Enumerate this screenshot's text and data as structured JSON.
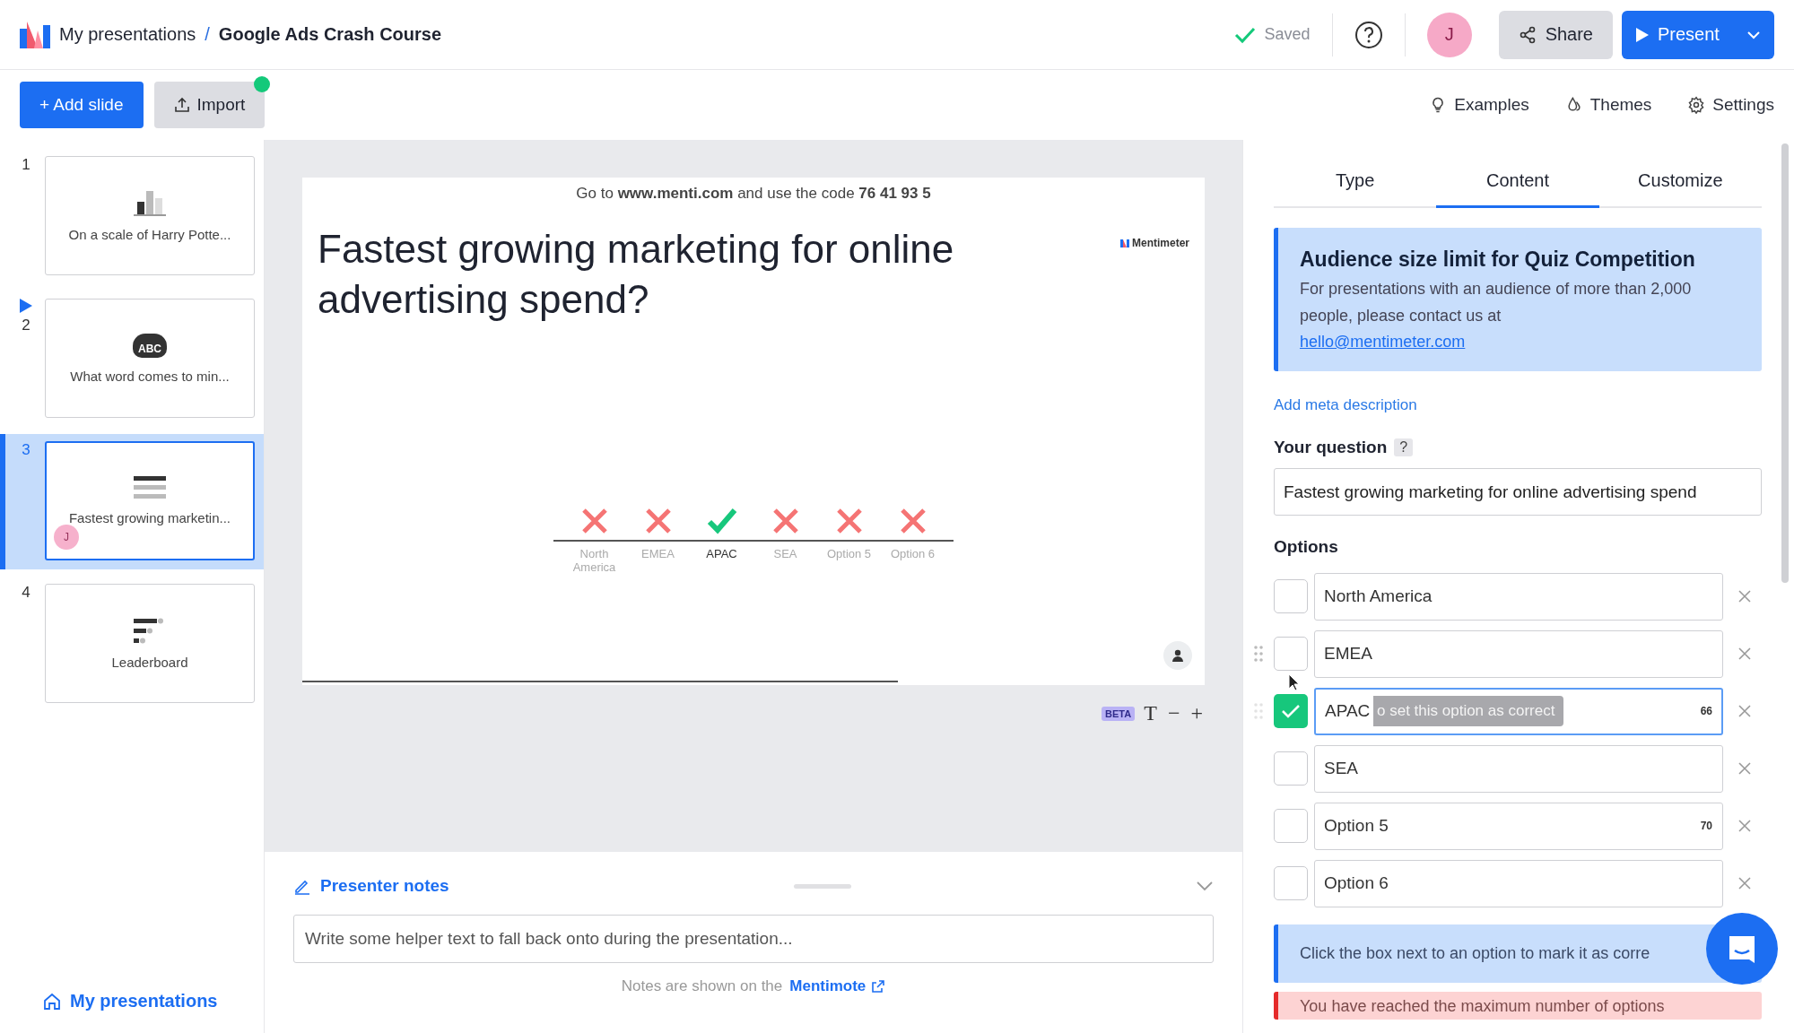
{
  "header": {
    "breadcrumb_root": "My presentations",
    "separator": "/",
    "title": "Google Ads Crash Course",
    "saved": "Saved",
    "avatar": "J",
    "share": "Share",
    "present": "Present"
  },
  "toolbar": {
    "add_slide": "+ Add slide",
    "import": "Import",
    "import_badge": true,
    "links": [
      {
        "kind": "bulb",
        "label": "Examples"
      },
      {
        "kind": "drop",
        "label": "Themes"
      },
      {
        "kind": "gear",
        "label": "Settings"
      }
    ]
  },
  "slides": [
    {
      "number": "1",
      "kind": "bar",
      "title": "On a scale of Harry Potte...",
      "selected": false,
      "live": false
    },
    {
      "number": "2",
      "kind": "wordcloud",
      "badge": "ABC",
      "title": "What word comes to min...",
      "selected": false,
      "live": true
    },
    {
      "number": "3",
      "kind": "quiz",
      "title": "Fastest growing marketin...",
      "selected": true,
      "live": false,
      "viewer": "J"
    },
    {
      "number": "4",
      "kind": "leaderboard",
      "title": "Leaderboard",
      "selected": false,
      "live": false
    }
  ],
  "home_link": "My presentations",
  "slide": {
    "instructions": "Go to **www.menti.com** and use the code **76 41 93 5**",
    "brand": "Mentimeter",
    "question": "Fastest growing marketing for online advertising spend?",
    "answers": [
      {
        "label": "North America",
        "correct": false
      },
      {
        "label": "EMEA",
        "correct": false
      },
      {
        "label": "APAC",
        "correct": true
      },
      {
        "label": "SEA",
        "correct": false
      },
      {
        "label": "Option 5",
        "correct": false
      },
      {
        "label": "Option 6",
        "correct": false
      }
    ],
    "beta": "BETA",
    "text_tool": "T",
    "minus": "−",
    "plus": "+"
  },
  "notes": {
    "title": "Presenter notes",
    "placeholder": "Write some helper text to fall back onto during the presentation...",
    "footer": "Notes are shown on the",
    "link": "Mentimote"
  },
  "panel": {
    "tabs": [
      {
        "label": "Type",
        "selected": false
      },
      {
        "label": "Content",
        "selected": true
      },
      {
        "label": "Customize",
        "selected": false
      }
    ],
    "notice": {
      "title": "Audience size limit for Quiz Competition",
      "body": "For presentations with an audience of more than 2,000 people, please contact us at",
      "email": "hello@mentimeter.com"
    },
    "meta_link": "Add meta description",
    "question_label": "Your question",
    "help": "?",
    "question_value": "Fastest growing marketing for online advertising spend",
    "options_label": "Options",
    "options": [
      {
        "value": "North America",
        "checked": false,
        "focused": false
      },
      {
        "value": "EMEA",
        "checked": false,
        "focused": false,
        "drag": true
      },
      {
        "value": "APAC",
        "checked": true,
        "focused": true,
        "drag": true,
        "counter": "66",
        "tooltip": "o set this option as correct"
      },
      {
        "value": "SEA",
        "checked": false,
        "focused": false
      },
      {
        "value": "Option 5",
        "checked": false,
        "focused": false,
        "counter": "70"
      },
      {
        "value": "Option 6",
        "checked": false,
        "focused": false
      }
    ],
    "hint": "Click the box next to an option to mark it as corre",
    "warning": "You have reached the maximum number of options"
  }
}
